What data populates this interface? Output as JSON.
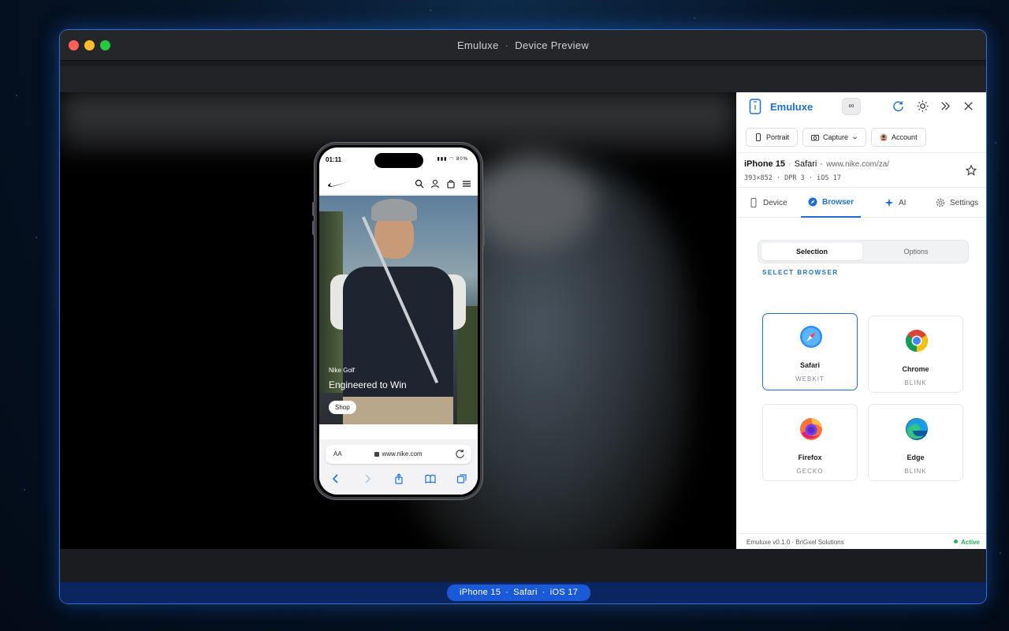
{
  "window": {
    "title_app": "Emuluxe",
    "title_view": "Device Preview"
  },
  "phone": {
    "clock": "01:11",
    "status_icons": "▮▮▮ ◠ 80%",
    "hero": {
      "kicker": "Nike Golf",
      "title": "Engineered to Win",
      "button": "Shop"
    },
    "url_bar": {
      "aa_label": "AA",
      "url": "www.nike.com"
    }
  },
  "panel": {
    "brand": "Emuluxe",
    "infinity_badge": "∞",
    "buttons": {
      "portrait": "Portrait",
      "capture": "Capture",
      "account": "Account"
    },
    "device": {
      "name": "iPhone 15",
      "browser": "Safari",
      "url": "www.nike.com/za/",
      "specs": "393×852 · DPR 3 · iOS 17"
    },
    "tabs": [
      {
        "label": "Device"
      },
      {
        "label": "Browser"
      },
      {
        "label": "AI"
      },
      {
        "label": "Settings"
      }
    ],
    "segment": {
      "selection": "Selection",
      "options": "Options"
    },
    "section_label": "SELECT BROWSER",
    "browsers": [
      {
        "name": "Safari",
        "engine": "WEBKIT"
      },
      {
        "name": "Chrome",
        "engine": "BLINK"
      },
      {
        "name": "Firefox",
        "engine": "GECKO"
      },
      {
        "name": "Edge",
        "engine": "BLINK"
      }
    ],
    "footer": {
      "left": "Emuluxe v0.1.0 · BriGxel Solutions",
      "status": "Active"
    }
  },
  "bottom_bar": {
    "device": "iPhone 15",
    "browser": "Safari",
    "os": "iOS 17"
  },
  "colors": {
    "accent": "#1d6fd6",
    "active_status": "#22b35a",
    "window_glow": "#2f6fd0"
  }
}
